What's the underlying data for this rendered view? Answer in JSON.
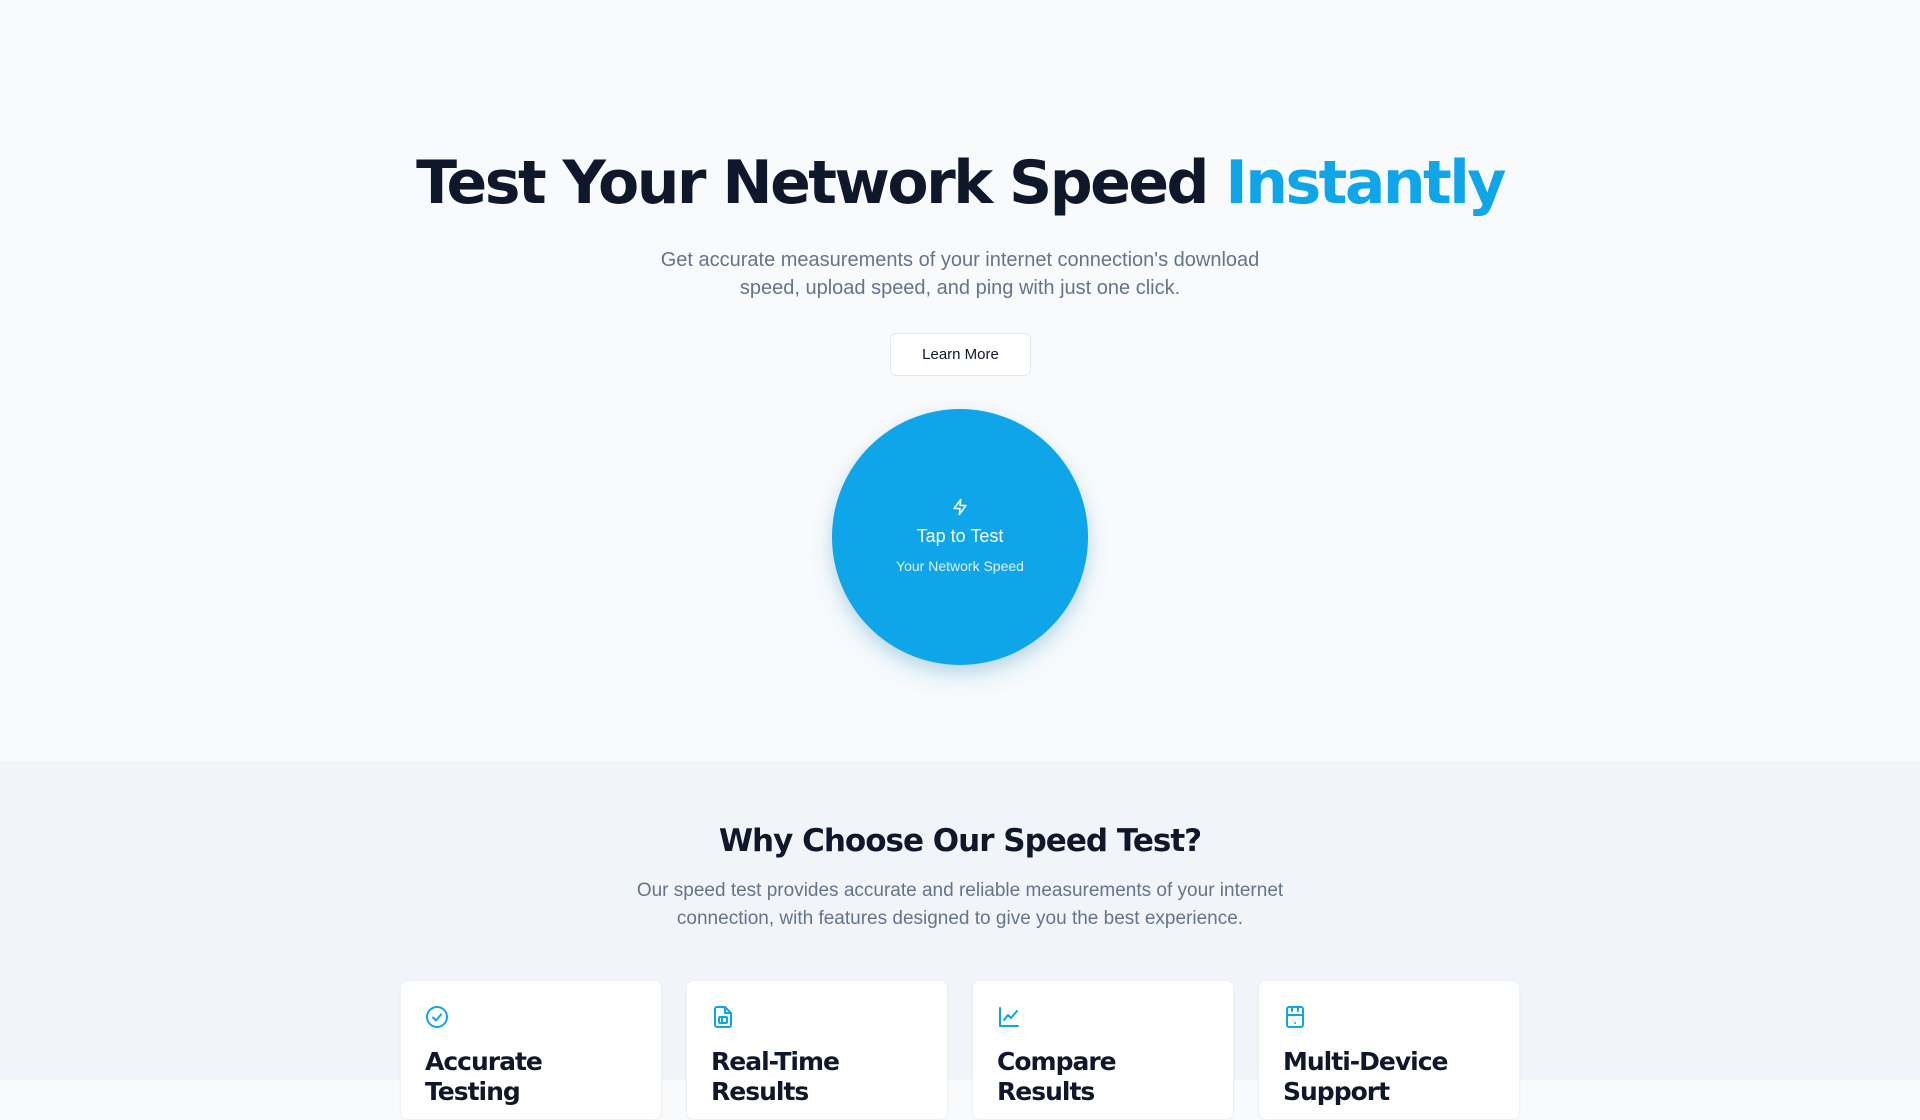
{
  "hero": {
    "title_main": "Test Your Network Speed",
    "title_accent": "Instantly",
    "subtitle": "Get accurate measurements of your internet connection's download speed, upload speed, and ping with just one click.",
    "learn_more_label": "Learn More",
    "test_button": {
      "label": "Tap to Test",
      "sublabel": "Your Network Speed",
      "icon": "bolt-icon"
    }
  },
  "features": {
    "title": "Why Choose Our Speed Test?",
    "subtitle": "Our speed test provides accurate and reliable measurements of your internet connection, with features designed to give you the best experience.",
    "cards": [
      {
        "icon": "check-circle-icon",
        "title": "Accurate Testing"
      },
      {
        "icon": "document-chart-icon",
        "title": "Real-Time Results"
      },
      {
        "icon": "line-chart-icon",
        "title": "Compare Results"
      },
      {
        "icon": "device-icon",
        "title": "Multi-Device Support"
      }
    ]
  },
  "colors": {
    "accent": "#0ea5e9",
    "heading": "#0f172a",
    "muted": "#64748b",
    "hero_bg": "#f8fafc",
    "features_bg": "#f1f5f9"
  }
}
